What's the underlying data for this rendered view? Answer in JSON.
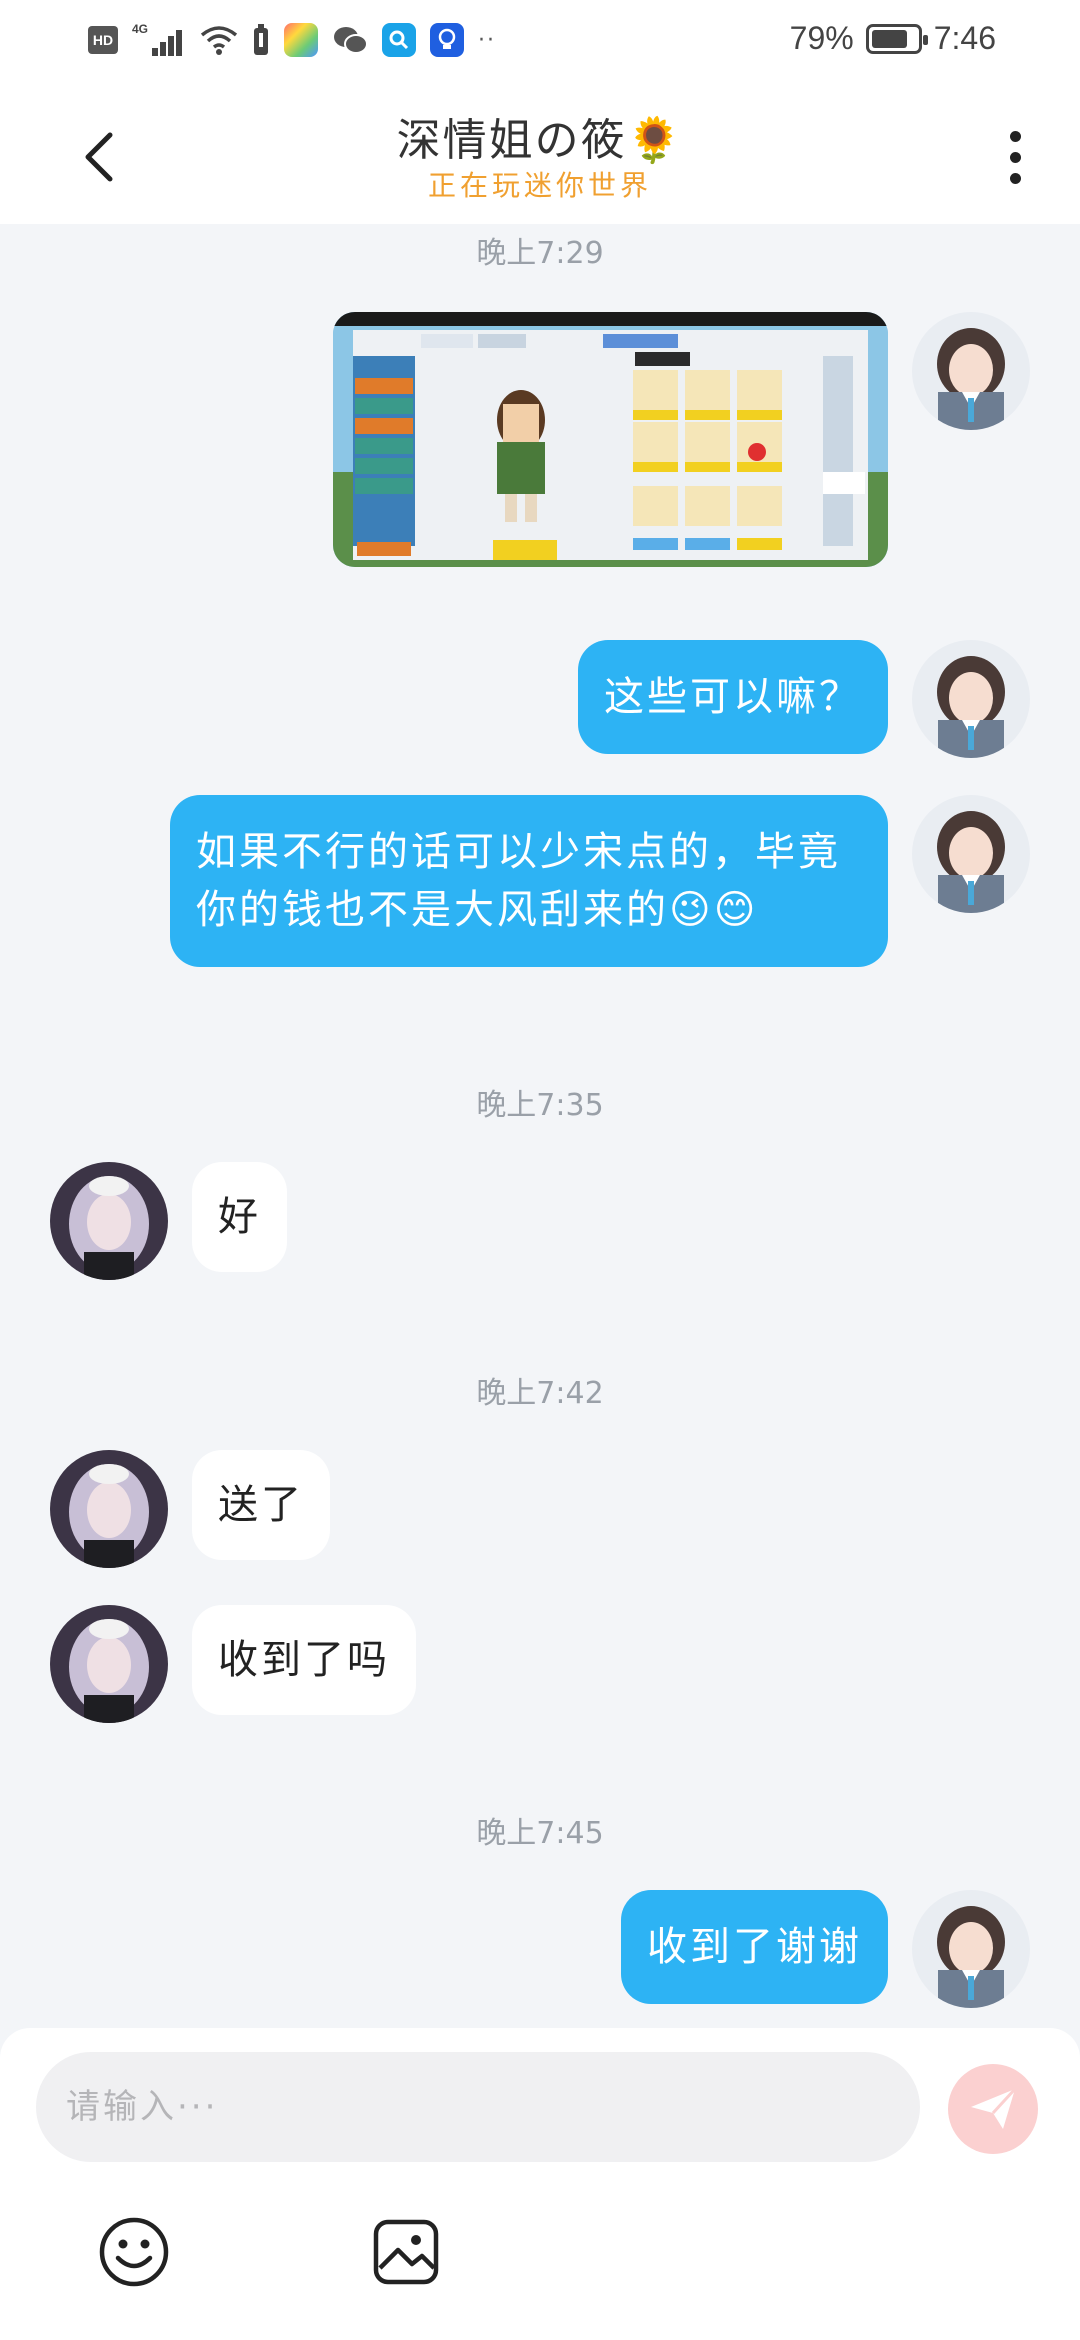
{
  "status_bar": {
    "hd_label": "HD",
    "network_label": "4G",
    "battery_percent": "79%",
    "battery_level": 0.79,
    "time": "7:46"
  },
  "header": {
    "title": "深情姐の筱🌻",
    "subtitle": "正在玩迷你世界"
  },
  "messages": {
    "t1": "晚上7:29",
    "m2": "这些可以嘛？",
    "m3": "如果不行的话可以少宋点的，毕竟你的钱也不是大风刮来的😉😊",
    "t2": "晚上7:35",
    "m4": "好",
    "t3": "晚上7:42",
    "m5": "送了",
    "m6": "收到了吗",
    "t4": "晚上7:45",
    "m7": "收到了谢谢"
  },
  "input": {
    "placeholder": "请输入···"
  },
  "icons": {
    "back": "chevron-left-icon",
    "more": "more-vertical-icon",
    "send": "send-icon",
    "emoji": "emoji-icon",
    "image": "image-icon"
  },
  "colors": {
    "outgoing_bubble": "#2db3f4",
    "incoming_bubble": "#ffffff",
    "subtitle": "#f0a030",
    "send_button": "#fbd0d0"
  }
}
